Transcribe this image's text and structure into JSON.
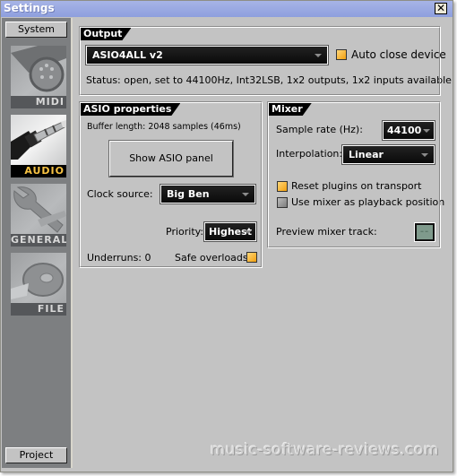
{
  "window": {
    "title": "Settings",
    "close_label": "✕"
  },
  "sidebar": {
    "top_button": "System",
    "bottom_button": "Project",
    "tiles": [
      {
        "label": "MIDI",
        "icon": "midi-connector-icon",
        "active": false
      },
      {
        "label": "AUDIO",
        "icon": "audio-jack-icon",
        "active": true
      },
      {
        "label": "GENERAL",
        "icon": "wrench-icon",
        "active": false
      },
      {
        "label": "FILE",
        "icon": "disc-icon",
        "active": false
      }
    ],
    "active_color": "#f7c243"
  },
  "output": {
    "title": "Output",
    "device": "ASIO4ALL v2",
    "auto_close_label": "Auto close device",
    "auto_close_checked": true,
    "status": "Status: open, set to 44100Hz, Int32LSB, 1x2 outputs, 1x2 inputs available"
  },
  "asio": {
    "title": "ASIO properties",
    "buffer_length": "Buffer length: 2048 samples (46ms)",
    "show_panel_label": "Show ASIO panel",
    "clock_source_label": "Clock source:",
    "clock_source_value": "Big Ben",
    "priority_label": "Priority:",
    "priority_value": "Highest",
    "underruns": "Underruns: 0",
    "safe_overloads_label": "Safe overloads",
    "safe_overloads_checked": true
  },
  "mixer": {
    "title": "Mixer",
    "sample_rate_label": "Sample rate (Hz):",
    "sample_rate_value": "44100",
    "interpolation_label": "Interpolation:",
    "interpolation_value": "Linear",
    "reset_plugins_label": "Reset plugins on transport",
    "reset_plugins_checked": true,
    "use_mixer_label": "Use mixer as playback position",
    "use_mixer_checked": false,
    "preview_track_label": "Preview mixer track:",
    "preview_track_value": "--"
  },
  "watermark": "music-software-reviews.com",
  "colors": {
    "checkbox_on": "#f19f0e",
    "titlebar": "#8e9fde",
    "panel_bg": "#c3c3c3"
  }
}
